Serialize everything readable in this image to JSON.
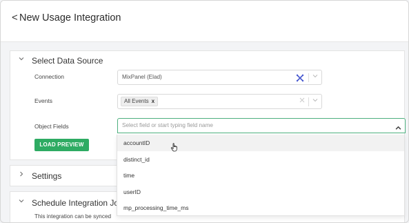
{
  "header": {
    "back": "<",
    "title": "New Usage Integration"
  },
  "data_source": {
    "title": "Select Data Source",
    "connection": {
      "label": "Connection",
      "value": "MixPanel (Elad)"
    },
    "events": {
      "label": "Events",
      "tag": "All Events",
      "tag_remove": "x"
    },
    "object_fields": {
      "label": "Object Fields",
      "placeholder": "Select field or start typing field name",
      "options": [
        "accountID",
        "distinct_id",
        "time",
        "userID",
        "mp_processing_time_ms"
      ]
    },
    "load_button": "LOAD PREVIEW"
  },
  "settings": {
    "title": "Settings"
  },
  "schedule": {
    "title": "Schedule Integration Job",
    "info": "This integration can be synced"
  },
  "colors": {
    "accent": "#2eab63",
    "focus_border": "#4caf7d",
    "connection_icon": "#4a5bd0"
  },
  "icons": [
    "chevron-down-icon",
    "chevron-right-icon",
    "chevron-up-icon",
    "connection-x-icon",
    "clear-icon",
    "hand-pointer-icon"
  ]
}
